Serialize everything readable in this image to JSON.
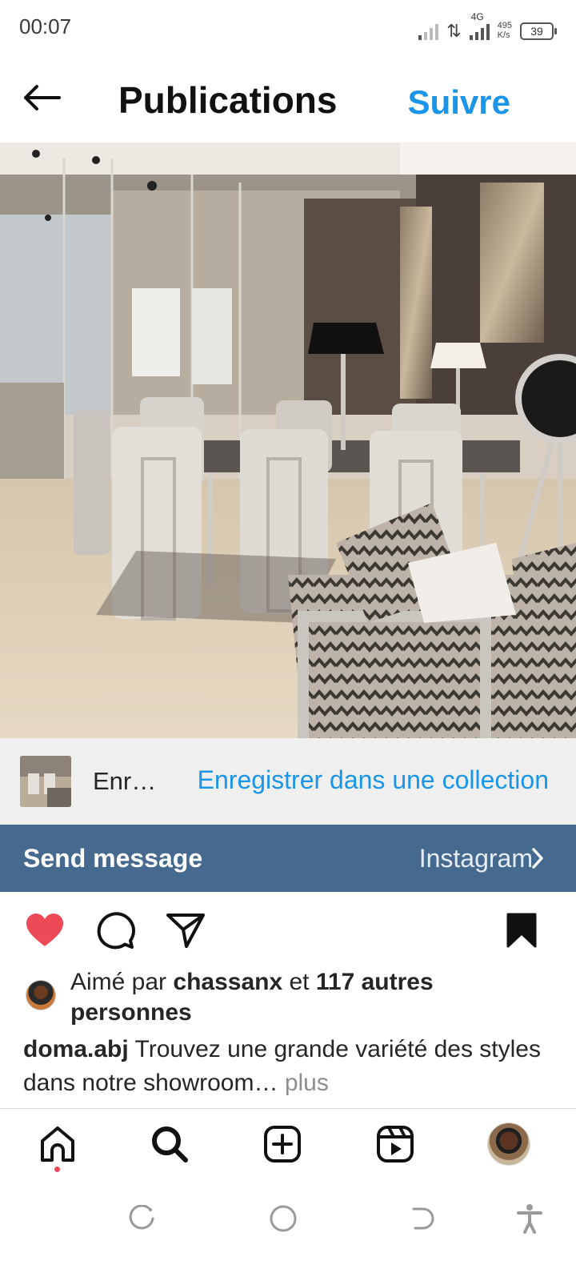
{
  "status_bar": {
    "time": "00:07",
    "network_type": "4G",
    "speed_value": "495",
    "speed_unit": "K/s",
    "battery": "39"
  },
  "header": {
    "title": "Publications",
    "follow_label": "Suivre",
    "back_icon": "arrow-left-icon"
  },
  "save_bar": {
    "label": "Enr…",
    "collection_label": "Enregistrer dans une collection"
  },
  "send_bar": {
    "label": "Send message",
    "source": "Instagram"
  },
  "actions": {
    "liked": true,
    "saved": true,
    "like_icon": "heart-filled-icon",
    "comment_icon": "comment-icon",
    "share_icon": "send-icon",
    "save_icon": "bookmark-filled-icon"
  },
  "likes": {
    "prefix": "Aimé par ",
    "user": "chassanx",
    "middle": " et ",
    "others": "117 autres personnes"
  },
  "caption": {
    "username": "doma.abj",
    "text": " Trouvez une grande variété des styles dans notre showroom…",
    "more": " plus"
  },
  "bottom_nav": {
    "items": [
      "home-icon",
      "search-icon",
      "create-icon",
      "reels-icon",
      "profile-avatar"
    ]
  },
  "colors": {
    "accent": "#1a95e8",
    "send_bar_bg": "#466a8f",
    "like_red": "#ed4956",
    "save_bar_bg": "#efefef"
  }
}
